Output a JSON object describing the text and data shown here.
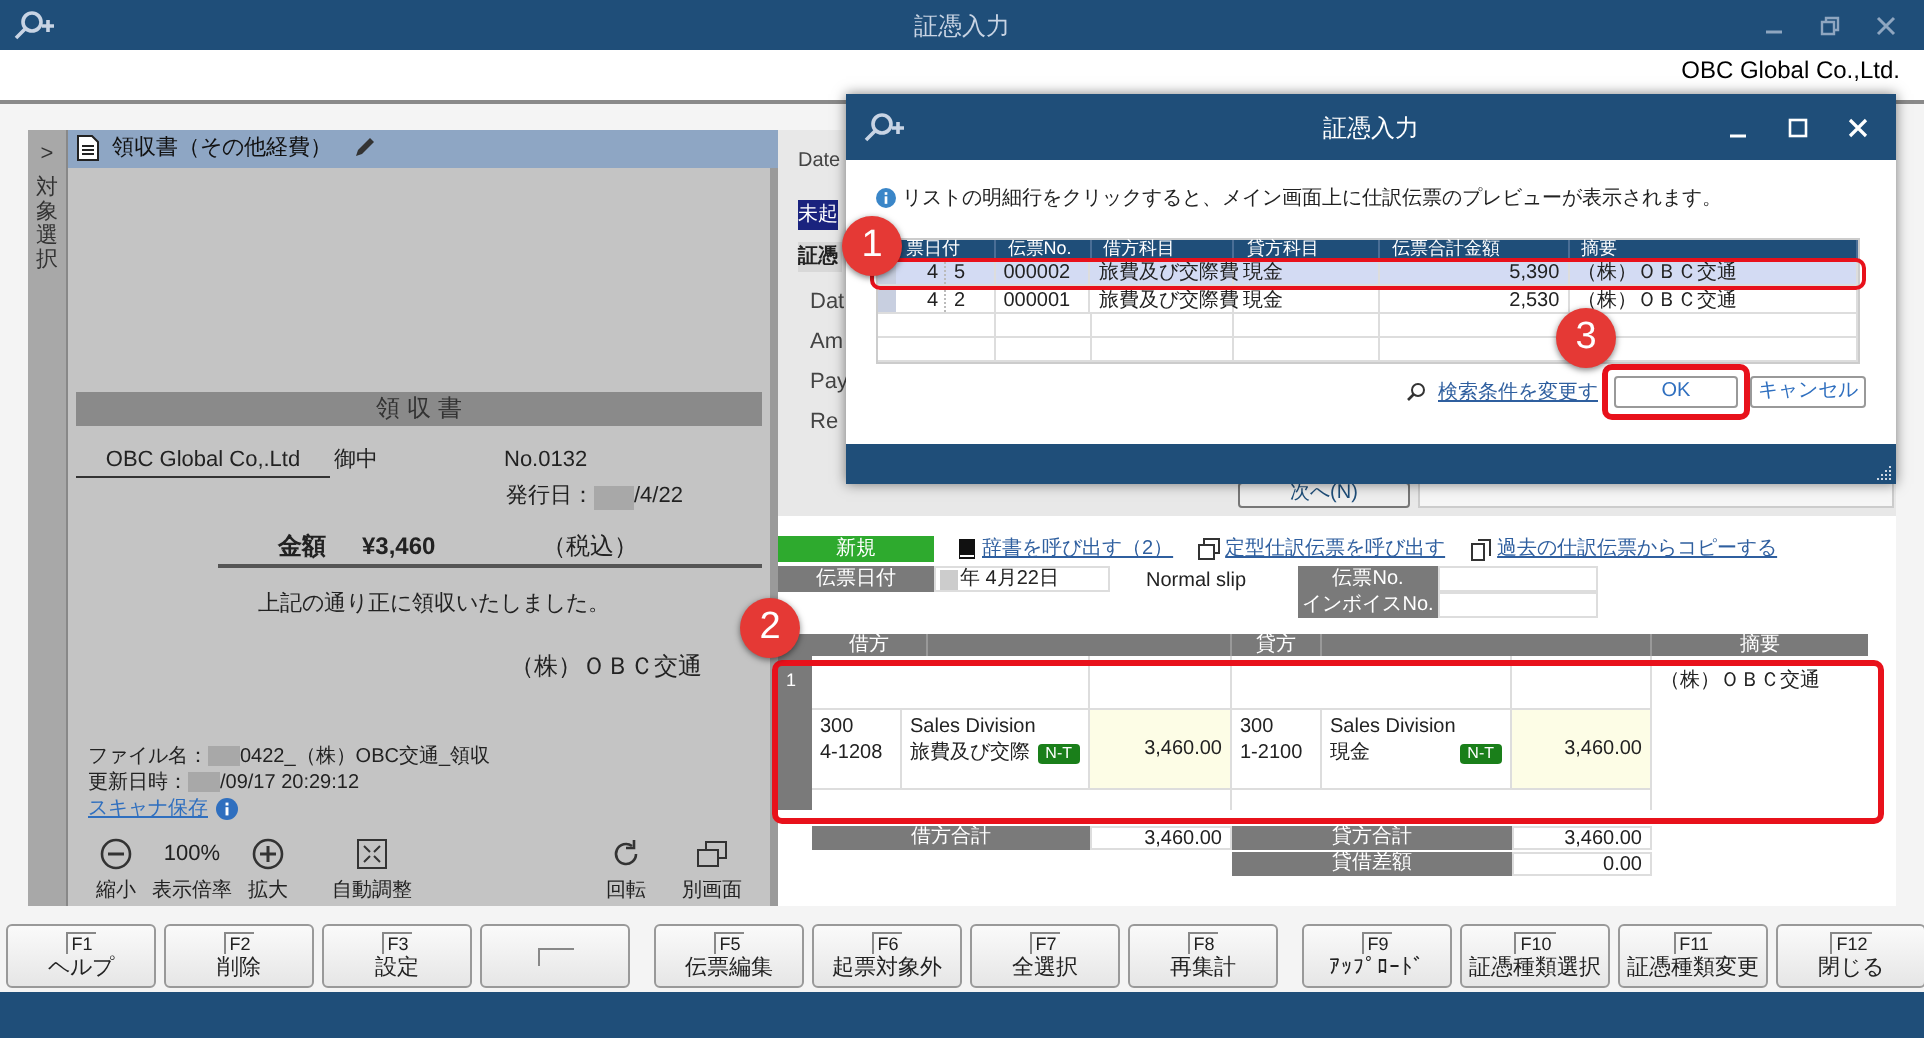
{
  "window": {
    "title": "証憑入力"
  },
  "company": "OBC Global Co.,Ltd.",
  "side_tab": {
    "arrow": ">",
    "label": "対象選択"
  },
  "document": {
    "title": "領収書（その他経費）",
    "receipt": {
      "heading": "領 収 書",
      "payee": "OBC Global Co,.Ltd",
      "honorific": "御中",
      "number": "No.0132",
      "issue_label": "発行日：",
      "issue_date": "/4/22",
      "amount_label": "金額",
      "amount": "¥3,460",
      "tax_note": "（税込）",
      "statement": "上記の通り正に領収いたしました。",
      "issuer": "（株）ＯＢＣ交通"
    },
    "file_label": "ファイル名：",
    "file_name": "0422_（株）OBC交通_領収",
    "updated_label": "更新日時：",
    "updated": "/09/17 20:29:12",
    "scanner_link": "スキャナ保存",
    "tools_left": [
      {
        "kind": "zoom_out",
        "label": "縮小"
      },
      {
        "kind": "value",
        "value": "100%",
        "label": "表示倍率"
      },
      {
        "kind": "zoom_in",
        "label": "拡大"
      },
      {
        "kind": "fit",
        "label": "自動調整"
      }
    ],
    "tools_right": [
      {
        "kind": "rotate",
        "label": "回転"
      },
      {
        "kind": "window",
        "label": "別画面"
      }
    ]
  },
  "detail_panel": {
    "date_label": "Date",
    "status_badge": "未起",
    "section": "証憑",
    "fields": [
      "Dat",
      "Am",
      "Pay",
      "Re"
    ],
    "next_button": "次へ(N)"
  },
  "journal": {
    "status_tag": "新規",
    "links": [
      {
        "kind": "book",
        "label": "辞書を呼び出す（2）"
      },
      {
        "kind": "template",
        "label": "定型仕訳伝票を呼び出す"
      },
      {
        "kind": "copy",
        "label": "過去の仕訳伝票からコピーする"
      }
    ],
    "date_label": "伝票日付",
    "date_value": "年 4月22日",
    "slip_type": "Normal slip",
    "slip_no_label": "伝票No.",
    "invoice_no_label": "インボイスNo.",
    "headers": {
      "debit": "借方",
      "credit": "貸方",
      "memo": "摘要"
    },
    "row": {
      "number": "1",
      "debit": {
        "dept": "300",
        "code": "4-1208",
        "division": "Sales Division",
        "account": "旅費及び交際",
        "tag": "N-T",
        "amount": "3,460.00"
      },
      "credit": {
        "dept": "300",
        "code": "1-2100",
        "division": "Sales Division",
        "account": "現金",
        "tag": "N-T",
        "amount": "3,460.00"
      },
      "memo": "（株）ＯＢＣ交通"
    },
    "totals": {
      "debit_label": "借方合計",
      "debit": "3,460.00",
      "credit_label": "貸方合計",
      "credit": "3,460.00",
      "diff_label": "貸借差額",
      "diff": "0.00"
    }
  },
  "function_keys": [
    [
      {
        "key": "F1",
        "label": "ヘルプ"
      },
      {
        "key": "F2",
        "label": "削除"
      },
      {
        "key": "F3",
        "label": "設定"
      },
      {
        "kind": "blank"
      }
    ],
    [
      {
        "key": "F5",
        "label": "伝票編集"
      },
      {
        "key": "F6",
        "label": "起票対象外"
      },
      {
        "key": "F7",
        "label": "全選択"
      },
      {
        "key": "F8",
        "label": "再集計"
      }
    ],
    [
      {
        "key": "F9",
        "label": "ｱｯﾌﾟﾛｰﾄﾞ"
      },
      {
        "key": "F10",
        "label": "証憑種類選択"
      },
      {
        "key": "F11",
        "label": "証憑種類変更"
      },
      {
        "key": "F12",
        "label": "閉じる"
      }
    ]
  ],
  "dialog": {
    "title": "証憑入力",
    "info": "リストの明細行をクリックすると、メイン画面上に仕訳伝票のプレビューが表示されます。",
    "columns": [
      "票日付",
      "伝票No.",
      "借方科目",
      "貸方科目",
      "伝票合計金額",
      "摘要"
    ],
    "rows": [
      {
        "month": "4",
        "day": "5",
        "no": "000002",
        "debit": "旅費及び交際費",
        "credit": "現金",
        "total": "5,390",
        "memo": "（株）ＯＢＣ交通",
        "selected": true
      },
      {
        "month": "4",
        "day": "2",
        "no": "000001",
        "debit": "旅費及び交際費",
        "credit": "現金",
        "total": "2,530",
        "memo": "（株）ＯＢＣ交通",
        "selected": false
      }
    ],
    "search_link": "検索条件を変更す",
    "buttons": [
      "OK",
      "キャンセル"
    ]
  },
  "annotations": [
    {
      "number": "1"
    },
    {
      "number": "2"
    },
    {
      "number": "3"
    }
  ]
}
